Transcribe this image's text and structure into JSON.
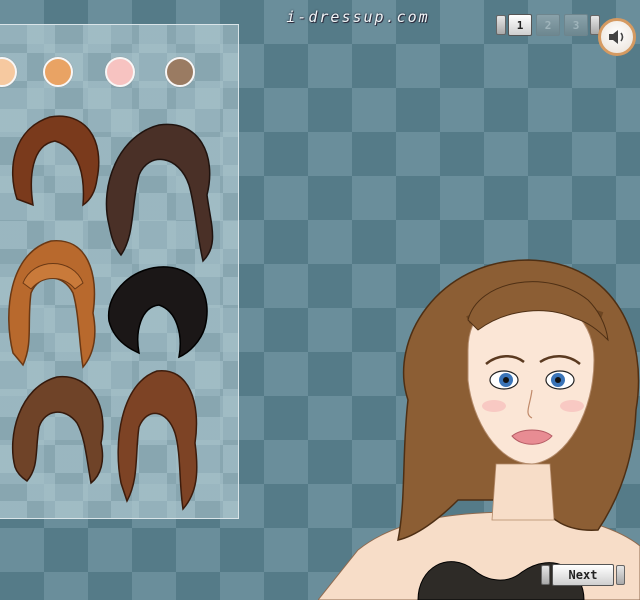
{
  "site": {
    "logo_text": "i-dressup.com"
  },
  "pagination": {
    "pages": [
      "1",
      "2",
      "3"
    ],
    "active_page": "1"
  },
  "sound": {
    "icon": "speaker-icon"
  },
  "palette": {
    "skin_tones": [
      "#f6c9a0",
      "#e9a364",
      "#f7c3c1",
      "#9a7b62"
    ]
  },
  "hairstyles": [
    {
      "name": "auburn-bob",
      "color": "#7a3a1c"
    },
    {
      "name": "long-dark-wavy",
      "color": "#4a3027"
    },
    {
      "name": "copper-bangs",
      "color": "#b8692d"
    },
    {
      "name": "black-short",
      "color": "#1b1717"
    },
    {
      "name": "brown-curly",
      "color": "#6f4328"
    },
    {
      "name": "chestnut-long-waves",
      "color": "#7d4325"
    }
  ],
  "model": {
    "hair_color": "#8c5e34",
    "eye_color": "#3a74b8"
  },
  "navigation": {
    "next_label": "Next"
  }
}
